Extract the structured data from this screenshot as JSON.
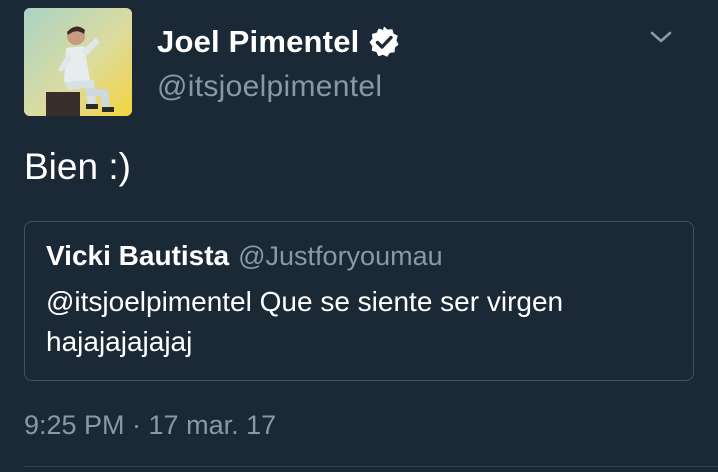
{
  "tweet": {
    "author": {
      "display_name": "Joel Pimentel",
      "handle": "@itsjoelpimentel",
      "verified": true,
      "avatar_icon": "profile-photo"
    },
    "text": "Bien :)",
    "quoted_tweet": {
      "author_name": "Vicki Bautista",
      "author_handle": "@Justforyoumau",
      "text": "@itsjoelpimentel Que se siente ser virgen hajajajajajaj"
    },
    "timestamp": "9:25 PM · 17 mar. 17",
    "menu_icon": "chevron-down-icon"
  },
  "colors": {
    "background": "#1b2836",
    "secondary_text": "#8899a6",
    "card_border": "#3d5466",
    "verified_badge": "#ffffff"
  }
}
